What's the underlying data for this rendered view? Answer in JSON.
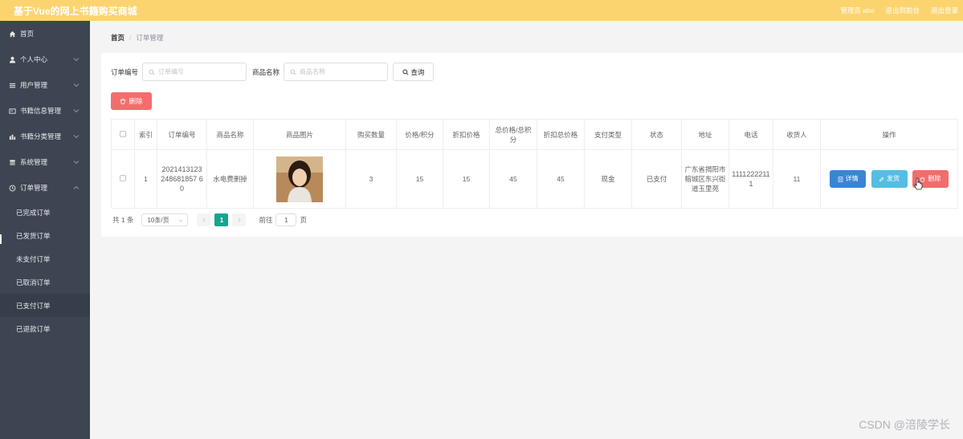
{
  "header": {
    "title": "基于Vue的网上书籍购买商城",
    "admin_label": "管理员 abo",
    "exit_to_front": "退出到前台",
    "logout": "退出登录"
  },
  "sidebar": {
    "items": [
      {
        "label": "首页",
        "icon": "home-icon"
      },
      {
        "label": "个人中心",
        "icon": "user-icon"
      },
      {
        "label": "用户管理",
        "icon": "list-icon"
      },
      {
        "label": "书籍信息管理",
        "icon": "book-icon"
      },
      {
        "label": "书籍分类管理",
        "icon": "chart-icon"
      },
      {
        "label": "系统管理",
        "icon": "system-icon"
      },
      {
        "label": "订单管理",
        "icon": "clock-icon"
      }
    ],
    "order_submenu": [
      "已完成订单",
      "已发货订单",
      "未支付订单",
      "已取消订单",
      "已支付订单",
      "已退款订单"
    ]
  },
  "breadcrumb": {
    "home": "首页",
    "separator": "/",
    "current": "订单管理"
  },
  "search": {
    "order_no_label": "订单编号",
    "order_no_placeholder": "订单编号",
    "product_label": "商品名称",
    "product_placeholder": "商品名称",
    "query_button": "查询"
  },
  "toolbar": {
    "delete_label": "删除"
  },
  "table": {
    "headers": [
      "索引",
      "订单编号",
      "商品名称",
      "商品图片",
      "购买数量",
      "价格/积分",
      "折扣价格",
      "总价格/总积分",
      "折扣总价格",
      "支付类型",
      "状态",
      "地址",
      "电话",
      "收货人",
      "操作"
    ],
    "rows": [
      {
        "index": "1",
        "order_no": "2021413123248681857 60",
        "product_name": "水电费删掉",
        "quantity": "3",
        "price": "15",
        "discount_price": "15",
        "total_price": "45",
        "discount_total": "45",
        "pay_type": "现金",
        "status": "已支付",
        "address": "广东省揭阳市榕城区东兴街道玉里苑",
        "phone": "11112222111",
        "receiver": "11",
        "actions": {
          "detail": "详情",
          "ship": "发货",
          "delete": "删除"
        }
      }
    ]
  },
  "pagination": {
    "total": "共 1 条",
    "page_size": "10条/页",
    "current_page": "1",
    "goto_prefix": "前往",
    "goto_value": "1",
    "goto_suffix": "页"
  },
  "watermark": "CSDN @涪陵学长",
  "colors": {
    "header_bg": "#fcd46f",
    "sidebar_bg": "#3d4553",
    "danger": "#f56c6c",
    "primary": "#3a84d6",
    "info": "#55bde3",
    "page_active": "#13a78f"
  }
}
